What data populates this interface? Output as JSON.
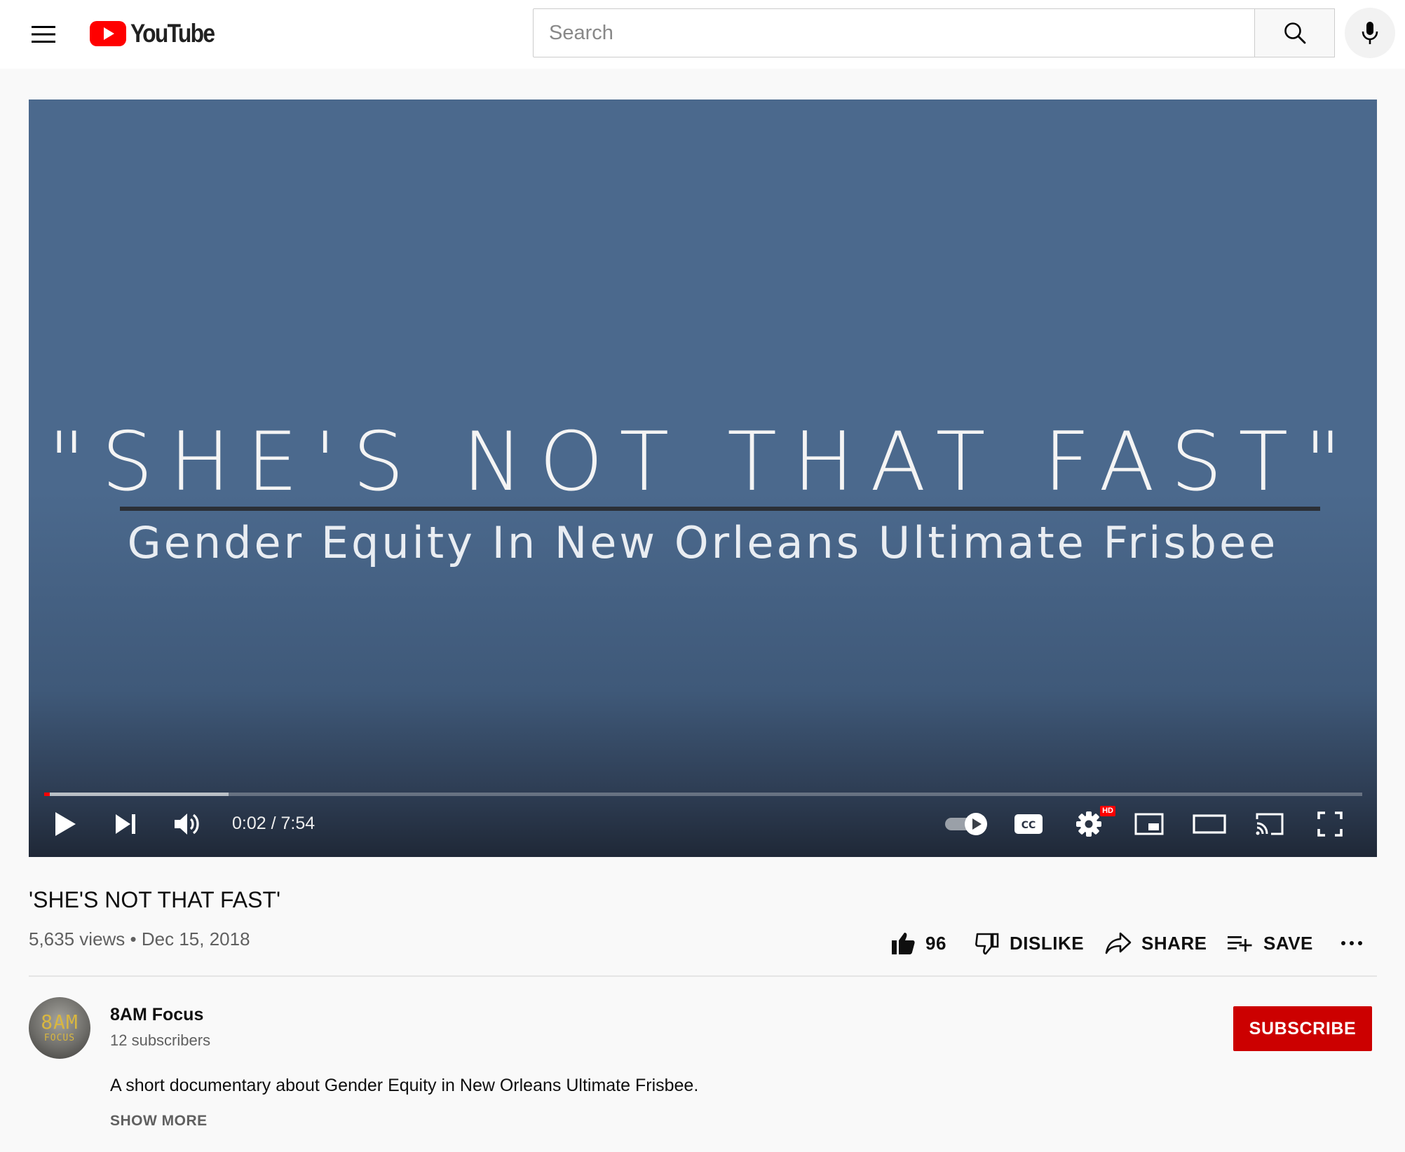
{
  "header": {
    "logo_text": "YouTube",
    "search_placeholder": "Search",
    "search_value": ""
  },
  "player": {
    "overlay_title": "\"SHE'S NOT THAT FAST\"",
    "overlay_subtitle": "Gender Equity In New Orleans Ultimate Frisbee",
    "current_time": "0:02",
    "duration": "7:54",
    "time_display": "0:02 / 7:54",
    "played_fraction": 0.0042,
    "buffered_fraction": 0.14,
    "autoplay_on": true,
    "quality_badge": "HD"
  },
  "video": {
    "title": "'SHE'S NOT THAT FAST'",
    "views": "5,635 views",
    "separator": "•",
    "date": "Dec 15, 2018"
  },
  "actions": {
    "like_count": "96",
    "dislike_label": "DISLIKE",
    "share_label": "SHARE",
    "save_label": "SAVE"
  },
  "channel": {
    "name": "8AM Focus",
    "subscribers": "12 subscribers",
    "avatar_text_top": "8AM",
    "avatar_text_bottom": "FOCUS",
    "subscribe_label": "SUBSCRIBE"
  },
  "description": {
    "text": "A short documentary about Gender Equity in New Orleans Ultimate Frisbee.",
    "show_more_label": "SHOW MORE"
  },
  "icons": {
    "menu": "hamburger-menu-icon",
    "logo": "youtube-play-logo-icon",
    "search": "magnifier-icon",
    "mic": "microphone-icon",
    "play": "play-icon",
    "next": "skip-next-icon",
    "volume": "speaker-icon",
    "autoplay": "autoplay-toggle-icon",
    "captions": "cc-icon",
    "settings": "gear-icon",
    "miniplayer": "miniplayer-icon",
    "theater": "theater-mode-icon",
    "cast": "cast-icon",
    "fullscreen": "fullscreen-icon",
    "like": "thumbs-up-icon",
    "dislike": "thumbs-down-icon",
    "share": "share-arrow-icon",
    "save": "playlist-add-icon",
    "more": "more-horizontal-icon"
  },
  "colors": {
    "brand_red": "#ff0000",
    "subscribe_red": "#cc0000",
    "video_background": "#4b698d",
    "page_background": "#f9f9f9",
    "secondary_text": "#606060"
  }
}
